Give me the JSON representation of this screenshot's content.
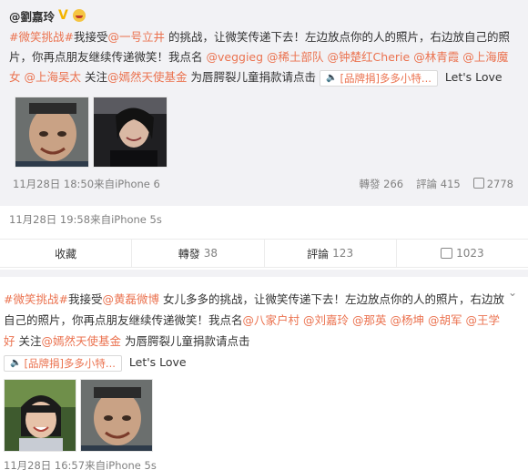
{
  "repost": {
    "author": "@劉嘉玲",
    "text": {
      "t1": "#微笑挑战#",
      "t2": "我接受",
      "t3": "@一号立井",
      "t4": " 的挑战，让微笑传递下去！左边放点你的人的照片，右边放自己的照片，你再点朋友继续传递微笑！我点名",
      "m1": "@veggieg",
      "m2": "@稀土部队",
      "m3": "@钟楚红Cherie",
      "m4": "@林青霞",
      "m5": "@上海魔女",
      "m6": "@上海吴太",
      "t5": " 关注",
      "m7": "@嫣然天使基金",
      "t6": " 为唇腭裂儿童捐款请点击",
      "link": "[品牌捐]多多小特...",
      "t7": " Let's Love"
    },
    "time": "11月28日 18:50来自iPhone 6",
    "forward": "轉發 266",
    "comment": "評論 415",
    "likes": "2778"
  },
  "post_meta": "11月28日 19:58来自iPhone 5s",
  "actions": {
    "favorite": "收藏",
    "forward_label": "轉發",
    "forward_count": "38",
    "comment_label": "評論",
    "comment_count": "123",
    "like_count": "1023"
  },
  "post2": {
    "text": {
      "t1": "#微笑挑战#",
      "t2": "我接受",
      "t3": "@黄磊微博",
      "t4": " 女儿多多的挑战，让微笑传递下去！左边放点你的人的照片，右边放自己的照片，你再点朋友继续传递微笑！我点名",
      "m1": "@八家户村",
      "m2": "@刘嘉玲",
      "m3": "@那英",
      "m4": "@杨坤",
      "m5": "@胡军",
      "m6": "@王学好",
      "t5": " 关注",
      "m7": "@嫣然天使基金",
      "t6": " 为唇腭裂儿童捐款请点击",
      "link": "[品牌捐]多多小特...",
      "t7": " Let's Love"
    },
    "meta": "11月28日 16:57来自iPhone 5s"
  },
  "icons": {
    "verified": "verified-v-icon",
    "emoji": "emoji-badge-icon",
    "speaker": "speaker-icon",
    "like": "thumbs-up-icon",
    "chevron": "chevron-down-icon"
  },
  "colors": {
    "link": "#eb7350",
    "repost_bg": "#f2f2f5",
    "meta": "#808080"
  }
}
